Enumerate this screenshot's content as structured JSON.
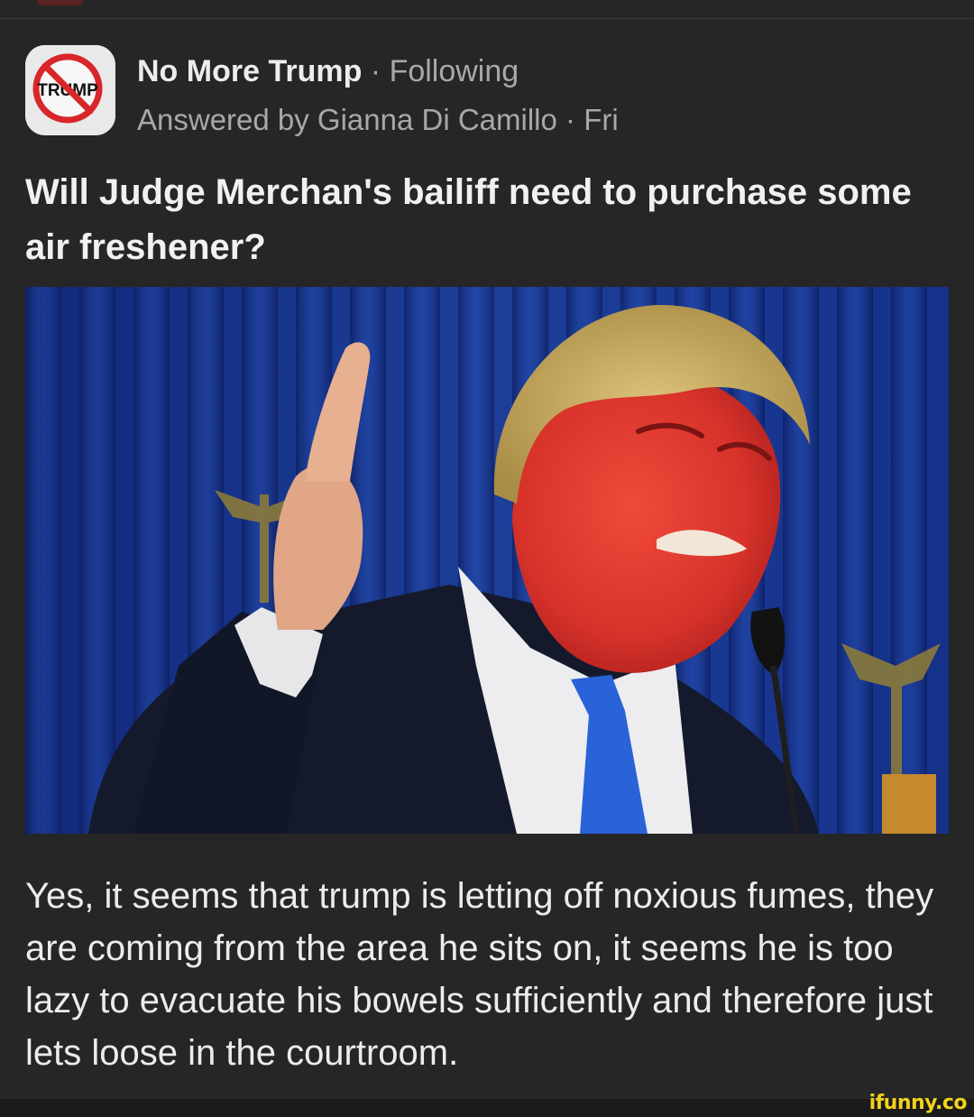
{
  "post": {
    "space": {
      "name": "No More Trump",
      "separator": " · ",
      "follow_status": "Following",
      "logo_text": "TRUMP"
    },
    "answer_meta": "Answered by Gianna Di Camillo · Fri",
    "question": "Will Judge Merchan's bailiff need to purchase some air freshener?",
    "answer_text": "Yes, it seems that trump is letting off noxious fumes, they are coming from the area he sits on, it seems he is too lazy to evacuate his bowels sufficiently and therefore just lets loose in the courtroom."
  },
  "watermark": "ifunny.co",
  "colors": {
    "background": "#262626",
    "primary_text": "#ececec",
    "secondary_text": "#a8a8a8",
    "logo_prohibition_red": "#d8262b",
    "watermark_yellow": "#f2d21c",
    "photo_curtain_blue": "#1d3f99",
    "tie_blue": "#2a63d8"
  },
  "icons": {
    "space_logo": "no-trump-prohibition-icon"
  }
}
